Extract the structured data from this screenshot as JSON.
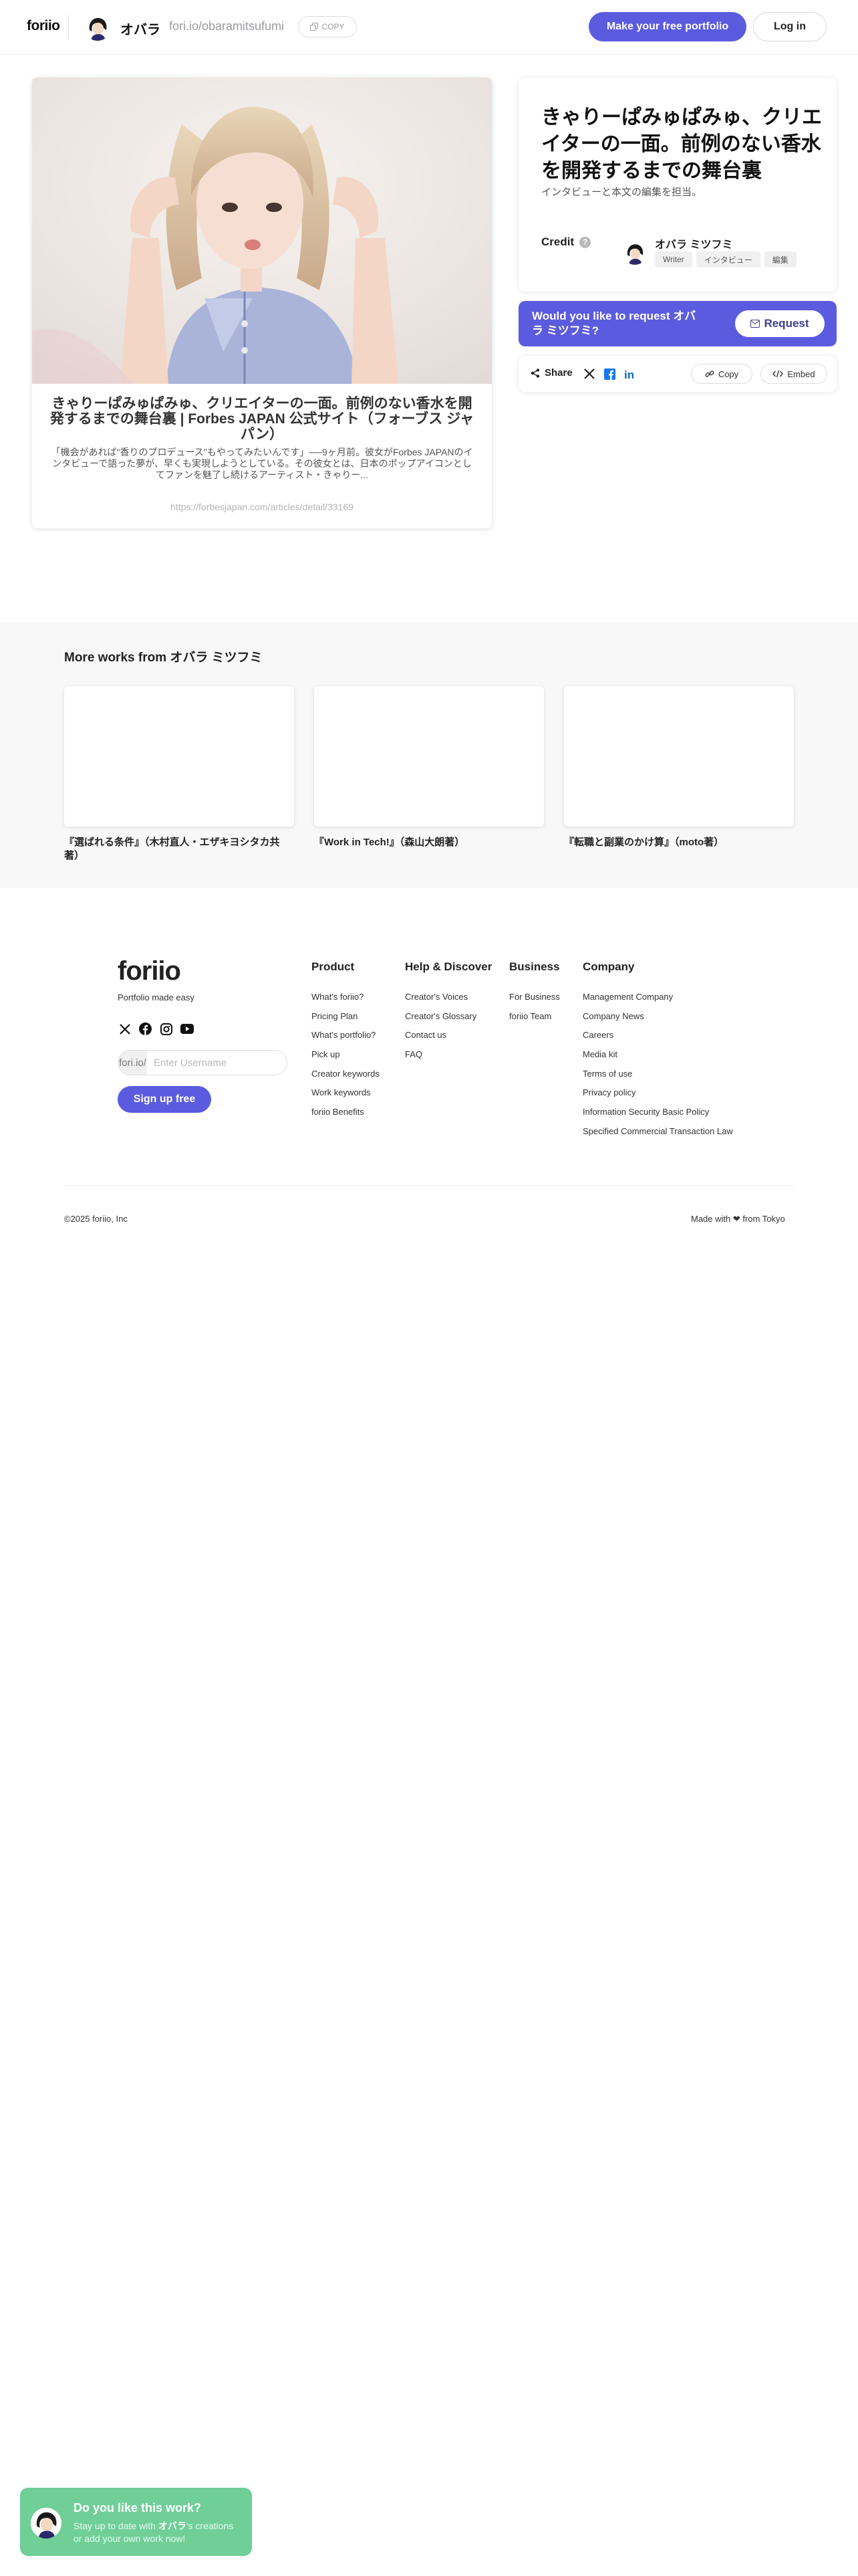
{
  "header": {
    "logo": "foriio",
    "profile_name": "オバラ",
    "profile_url": "fori.io/obaramitsufumi",
    "copy_label": "COPY",
    "cta_label": "Make your free portfolio",
    "login_label": "Log in"
  },
  "work": {
    "title": "きゃりーぱみゅぱみゅ、クリエイターの一面。前例のない香水を開発するまでの舞台裏 | Forbes JAPAN 公式サイト（フォーブス ジャパン）",
    "description": "「機会があれば\"香りのプロデュース\"もやってみたいんです」──9ヶ月前。彼女がForbes JAPANのインタビューで語った夢が、早くも実現しようとしている。その彼女とは、日本のポップアイコンとしてファンを魅了し続けるアーティスト・きゃりー...",
    "link": "https://forbesjapan.com/articles/detail/33169"
  },
  "info": {
    "title": "きゃりーぱみゅぱみゅ、クリエイターの一面。前例のない香水を開発するまでの舞台裏",
    "subtitle": "インタビューと本文の編集を担当。",
    "credit_label": "Credit",
    "help_glyph": "?",
    "credit_name": "オバラ ミツフミ",
    "tags": [
      "Writer",
      "インタビュー",
      "編集"
    ]
  },
  "request": {
    "text": "Would you like to request オバラ ミツフミ?",
    "button_label": "Request"
  },
  "share": {
    "label": "Share",
    "copy_label": "Copy",
    "embed_label": "Embed",
    "icons": [
      "share-icon",
      "x-icon",
      "facebook-icon",
      "linkedin-icon",
      "link-icon",
      "code-icon"
    ]
  },
  "more_works": {
    "title": "More works from オバラ ミツフミ",
    "items": [
      {
        "caption": "『選ばれる条件』（木村直人・エザキヨシタカ共著）"
      },
      {
        "caption": "『Work in Tech!』（森山大朗著）"
      },
      {
        "caption": "『転職と副業のかけ算』（moto著）"
      }
    ]
  },
  "footer": {
    "logo": "foriio",
    "tagline": "Portfolio made easy",
    "input_prefix": "fori.io/",
    "input_placeholder": "Enter Username",
    "signup_label": "Sign up free",
    "columns": [
      {
        "title": "Product",
        "links": [
          "What's foriio?",
          "Pricing Plan",
          "What's portfolio?",
          "Pick up",
          "Creator keywords",
          "Work keywords",
          "foriio Benefits"
        ]
      },
      {
        "title": "Help & Discover",
        "links": [
          "Creator's Voices",
          "Creator's Glossary",
          "Contact us",
          "FAQ"
        ]
      },
      {
        "title": "Business",
        "links": [
          "For Business",
          "foriio Team"
        ]
      },
      {
        "title": "Company",
        "links": [
          "Management Company",
          "Company News",
          "Careers",
          "Media kit",
          "Terms of use",
          "Privacy policy",
          "Information Security Basic Policy",
          "Specified Commercial Transaction Law"
        ]
      }
    ],
    "copyright": "©2025 foriio, Inc",
    "made_with": "Made with ❤ from Tokyo"
  },
  "toast": {
    "title": "Do you like this work?",
    "text_before": "Stay up to date with ",
    "text_name": "オバラ",
    "text_after": "'s creations or add your own work now!"
  },
  "colors": {
    "accent": "#5b5bdf",
    "toast": "#6fcf97",
    "section_bg": "#f8f8f8"
  }
}
